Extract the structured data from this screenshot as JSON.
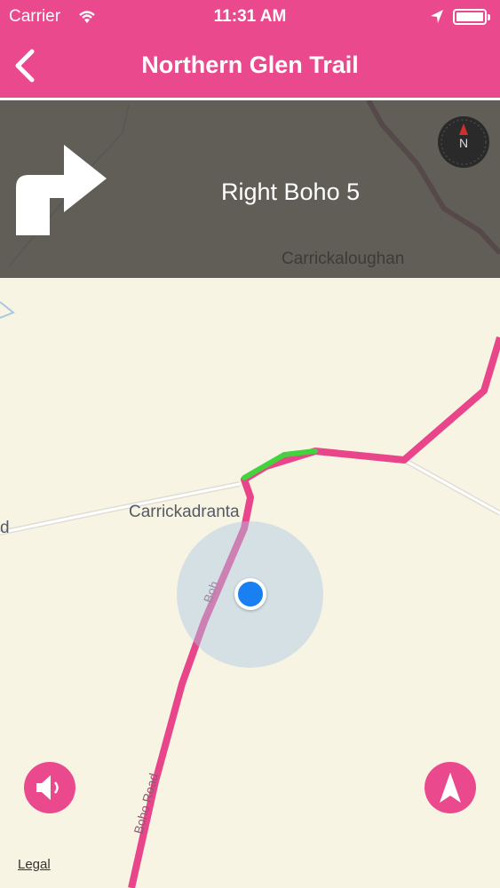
{
  "status_bar": {
    "carrier": "Carrier",
    "time": "11:31 AM"
  },
  "nav": {
    "title": "Northern Glen Trail"
  },
  "instruction": {
    "text": "Right Boho 5",
    "turn": "right-turn-arrow-icon"
  },
  "compass": {
    "label": "N"
  },
  "map": {
    "labels": {
      "carrickaloughan": "Carrickaloughan",
      "carrickadranta": "Carrickadranta",
      "road_edge": "d"
    },
    "route_color": "#e8458b",
    "progress_color": "#44d23e",
    "location_color": "#1a7ff0"
  },
  "controls": {
    "sound": "speaker-icon",
    "locate": "navigation-arrow-icon",
    "legal": "Legal"
  },
  "colors": {
    "accent": "#ea4a8d",
    "map_background": "#f8f4e3",
    "banner": "#504e48"
  }
}
